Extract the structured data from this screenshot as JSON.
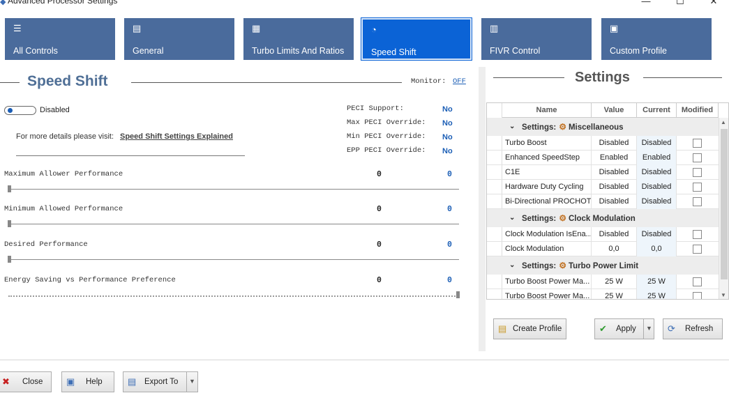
{
  "window": {
    "title": "Advanced Processor Settings",
    "icon": "app-icon",
    "minimize": "—",
    "maximize": "☐",
    "close": "✕"
  },
  "tabs": [
    {
      "label": "All Controls",
      "icon": "sliders-icon",
      "glyph": "☰",
      "active": false
    },
    {
      "label": "General",
      "icon": "document-icon",
      "glyph": "▤",
      "active": false
    },
    {
      "label": "Turbo Limits And Ratios",
      "icon": "cpu-icon",
      "glyph": "▦",
      "active": false
    },
    {
      "label": "Speed Shift",
      "icon": "gauge-icon",
      "glyph": "◔",
      "active": true
    },
    {
      "label": "FIVR Control",
      "icon": "chip-icon",
      "glyph": "▥",
      "active": false
    },
    {
      "label": "Custom Profile",
      "icon": "profile-icon",
      "glyph": "▣",
      "active": false
    }
  ],
  "speed_shift": {
    "title": "Speed Shift",
    "monitor_label": "Monitor:",
    "monitor_value": "OFF",
    "toggle_label": "Disabled",
    "details_text": "For more details please visit:",
    "details_link": "Speed Shift Settings Explained",
    "peci": [
      {
        "label": "PECI Support:",
        "value": "No"
      },
      {
        "label": "Max PECI Override:",
        "value": "No"
      },
      {
        "label": "Min PECI Override:",
        "value": "No"
      },
      {
        "label": "EPP PECI Override:",
        "value": "No"
      }
    ],
    "sliders": [
      {
        "label": "Maximum Allower Performance",
        "value": "0",
        "current": "0",
        "level": 0
      },
      {
        "label": "Minimum Allowed Performance",
        "value": "0",
        "current": "0",
        "level": 0
      },
      {
        "label": "Desired Performance",
        "value": "0",
        "current": "0",
        "level": 0
      },
      {
        "label": "Energy Saving vs Performance Preference",
        "value": "0",
        "current": "0",
        "level": 1
      }
    ]
  },
  "settings_panel": {
    "title": "Settings",
    "columns": {
      "name": "Name",
      "value": "Value",
      "current": "Current",
      "modified": "Modified"
    },
    "group_prefix": "Settings:",
    "groups": [
      {
        "name": "Miscellaneous",
        "rows": [
          {
            "name": "Turbo Boost",
            "value": "Disabled",
            "current": "Disabled"
          },
          {
            "name": "Enhanced SpeedStep",
            "value": "Enabled",
            "current": "Enabled"
          },
          {
            "name": "C1E",
            "value": "Disabled",
            "current": "Disabled"
          },
          {
            "name": "Hardware Duty Cycling",
            "value": "Disabled",
            "current": "Disabled"
          },
          {
            "name": "Bi-Directional PROCHOT",
            "value": "Disabled",
            "current": "Disabled"
          }
        ]
      },
      {
        "name": "Clock Modulation",
        "rows": [
          {
            "name": "Clock Modulation IsEna...",
            "value": "Disabled",
            "current": "Disabled"
          },
          {
            "name": "Clock Modulation",
            "value": "0,0",
            "current": "0,0"
          }
        ]
      },
      {
        "name": "Turbo Power Limit",
        "rows": [
          {
            "name": "Turbo Boost Power Ma...",
            "value": "25 W",
            "current": "25 W"
          },
          {
            "name": "Turbo Boost Power Ma...",
            "value": "25 W",
            "current": "25 W"
          }
        ]
      }
    ],
    "buttons": {
      "create_profile": "Create Profile",
      "apply": "Apply",
      "refresh": "Refresh"
    }
  },
  "footer": {
    "close": "Close",
    "help": "Help",
    "export": "Export To"
  },
  "colors": {
    "tab_bg": "#4a6b9c",
    "tab_active": "#0b63d6",
    "accent_blue": "#1a5db5",
    "title_color": "#4f6f96"
  }
}
